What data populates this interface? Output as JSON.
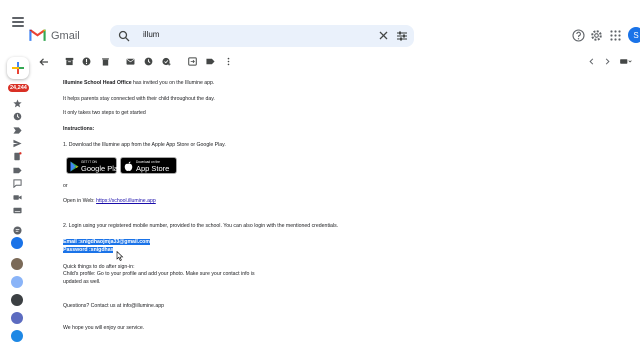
{
  "header": {
    "app_name": "Gmail",
    "search_value": "illum",
    "account_initial": "S"
  },
  "sidebar": {
    "unread_badge": "24,244"
  },
  "toolbar": {
    "page_nav": ""
  },
  "email": {
    "intro_sender": "Illumine School Head Office",
    "intro_rest": " has invited you on the Illumine app.",
    "line_helps": "It helps parents stay connected with their child throughout the day.",
    "line_steps": "It only takes two steps to get started",
    "instructions_heading": "Instructions:",
    "step1": "1. Download the Illumine app from the Apple App Store or Google Play.",
    "google_play_small": "GET IT ON",
    "google_play_big": "Google Play",
    "app_store_small": "Download on the",
    "app_store_big": "App Store",
    "or_text": "or",
    "open_web_prefix": "Open in Web: ",
    "open_web_link": "https://school.illumine.app",
    "step2": "2. Login using your registered mobile number, provided to the school. You can also login with the mentioned credentials.",
    "email_label": "Email :",
    "email_value": "snigdhaojmja33@gmail.com",
    "password_label": "Password :",
    "password_value": "snigdhas",
    "after_heading": "Quick things to do after sign-in:",
    "after_line1": "Child's profile: Go to your profile and add your photo. Make sure your contact info is",
    "after_line2": "updated as well.",
    "questions": "Questions? Contact us at info@illumine.app",
    "closing": "We hope you will enjoy our service."
  },
  "colors": {
    "accent": "#1a73e8",
    "badge": "#d93025",
    "search_bg": "#eaf1fb",
    "link": "#1a0dab"
  }
}
